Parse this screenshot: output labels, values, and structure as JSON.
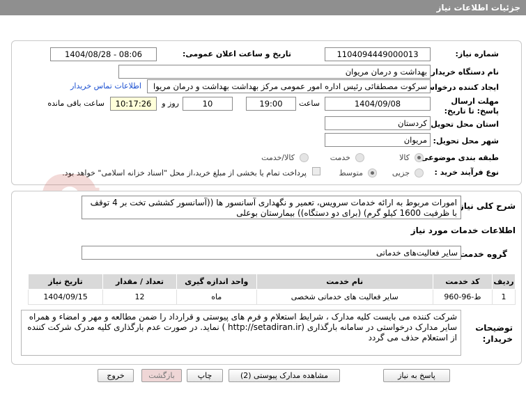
{
  "title": "جزئیات اطلاعات نیاز",
  "form": {
    "need_number_label": "شماره نیاز:",
    "need_number": "1104094449000013",
    "announce_label": "تاریخ و ساعت اعلان عمومی:",
    "announce_value": "1404/08/28 - 08:06",
    "buyer_org_label": "نام دستگاه خریدار:",
    "buyer_org": "بهداشت و درمان مریوان",
    "requester_label": "ایجاد کننده درخواست:",
    "requester": "سرکوت مصطفائی رئیس اداره امور عمومی مرکز بهداشت بهداشت و درمان مریوا",
    "contact_link": "اطلاعات تماس خریدار",
    "deadline_label": "مهلت ارسال پاسخ: تا تاریخ:",
    "deadline_date": "1404/09/08",
    "time_label": "ساعت",
    "deadline_time": "19:00",
    "days_value": "10",
    "days_label": "روز و",
    "remaining_time": "10:17:26",
    "remaining_label": "ساعت باقی مانده",
    "province_label": "استان محل تحویل:",
    "province": "کردستان",
    "city_label": "شهر محل تحویل:",
    "city": "مریوان",
    "category_label": "طبقه بندی موضوعی:",
    "category_options": [
      "کالا",
      "خدمت",
      "کالا/خدمت"
    ],
    "process_label": "نوع فرآیند خرید :",
    "process_options": [
      "جزیی",
      "متوسط"
    ],
    "process_note": "پرداخت تمام یا بخشی از مبلغ خرید،از محل \"اسناد خزانه اسلامی\" خواهد بود."
  },
  "summary": {
    "label": "شرح کلی نیاز:",
    "text": "امورات مربوط به ارائه خدمات سرویس، تعمیر و نگهداری آسانسور ها ((آسانسور کششی تخت بر 4 توقف با ظرفیت 1600 کیلو گرم) (برای دو دستگاه)) بیمارستان بوعلی"
  },
  "services": {
    "section_title": "اطلاعات خدمات مورد نیاز",
    "group_label": "گروه خدمت:",
    "group_value": "سایر فعالیت‌های خدماتی",
    "headers": [
      "ردیف",
      "کد خدمت",
      "نام خدمت",
      "واحد اندازه گیری",
      "تعداد / مقدار",
      "تاریخ نیاز"
    ],
    "rows": [
      [
        "1",
        "ط-96-960",
        "سایر فعالیت های خدماتی شخصی",
        "ماه",
        "12",
        "1404/09/15"
      ]
    ]
  },
  "buyer_notes": {
    "label": "توضیحات خریدار:",
    "text": "شرکت کننده می بایست  کلیه مدارک ، شرایط استعلام و فرم های پیوستی و قرارداد را ضمن مطالعه و مهر و امضاء و همراه سایر مدارک درخواستی در سامانه بارگذاری  (http://setadiran.ir  )  نماید. در صورت عدم بارگذاری کلیه مدرک شرکت کننده از استعلام حذف می گردد"
  },
  "buttons": {
    "reply": "پاسخ به نیاز",
    "attachments": "مشاهده مدارک پیوستی (2)",
    "print": "چاپ",
    "back": "بازگشت",
    "exit": "خروج"
  },
  "watermark": {
    "text": "AriaTender.net"
  },
  "colors": {
    "title_bar": "#8f8f8f",
    "link": "#1a4fd1",
    "time_highlight": "#ffffd9",
    "table_header": "#d9d9d9",
    "watermark": "#c0392b"
  }
}
